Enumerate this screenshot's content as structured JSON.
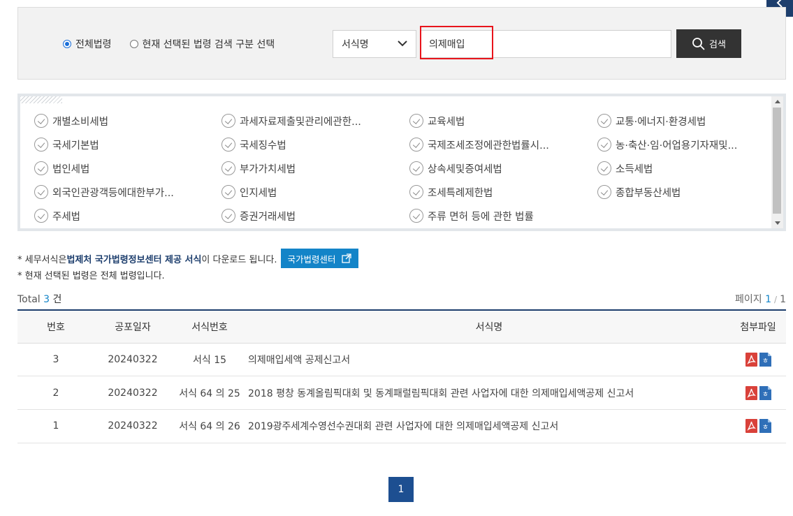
{
  "search": {
    "radio_all_label": "전체법령",
    "radio_selected_label": "현재 선택된 법령 검색 구분 선택",
    "select_value": "서식명",
    "query_value": "의제매입",
    "button_label": "검색"
  },
  "laws": [
    "개별소비세법",
    "과세자료제출및관리에관한...",
    "교육세법",
    "교통·에너지·환경세법",
    "국세기본법",
    "국세징수법",
    "국제조세조정에관한법률시...",
    "농·축산·임·어업용기자재및...",
    "법인세법",
    "부가가치세법",
    "상속세및증여세법",
    "소득세법",
    "외국인관광객등에대한부가...",
    "인지세법",
    "조세특례제한법",
    "종합부동산세법",
    "주세법",
    "증권거래세법",
    "주류 면허 등에 관한 법률"
  ],
  "notice": {
    "prefix": "* 세무서식은 ",
    "bold": "법제처 국가법령정보센터 제공 서식",
    "suffix": "이 다운로드 됩니다.",
    "button_label": "국가법령센터",
    "line2": "* 현재 선택된 법령은 전체 법령입니다."
  },
  "summary": {
    "total_label": "Total",
    "total_count": "3",
    "total_unit": "건",
    "page_label": "페이지",
    "page_current": "1",
    "page_sep": "/",
    "page_total": "1"
  },
  "table": {
    "headers": [
      "번호",
      "공포일자",
      "서식번호",
      "서식명",
      "첨부파일"
    ],
    "rows": [
      {
        "no": "3",
        "date": "20240322",
        "form_no": "서식 15",
        "title": "의제매입세액 공제신고서"
      },
      {
        "no": "2",
        "date": "20240322",
        "form_no": "서식 64 의 25",
        "title": "2018 평창 동계올림픽대회 및 동계패럴림픽대회 관련 사업자에 대한 의제매입세액공제 신고서"
      },
      {
        "no": "1",
        "date": "20240322",
        "form_no": "서식 64 의 26",
        "title": "2019광주세계수영선수권대회 관련 사업자에 대한 의제매입세액공제 신고서"
      }
    ]
  },
  "pagination": {
    "current": "1"
  },
  "colors": {
    "navy": "#1d3e6d",
    "blue": "#1384c8",
    "pdf_red": "#d9413a",
    "hwp_blue": "#2f6fb8",
    "highlight": "#e8141b"
  }
}
